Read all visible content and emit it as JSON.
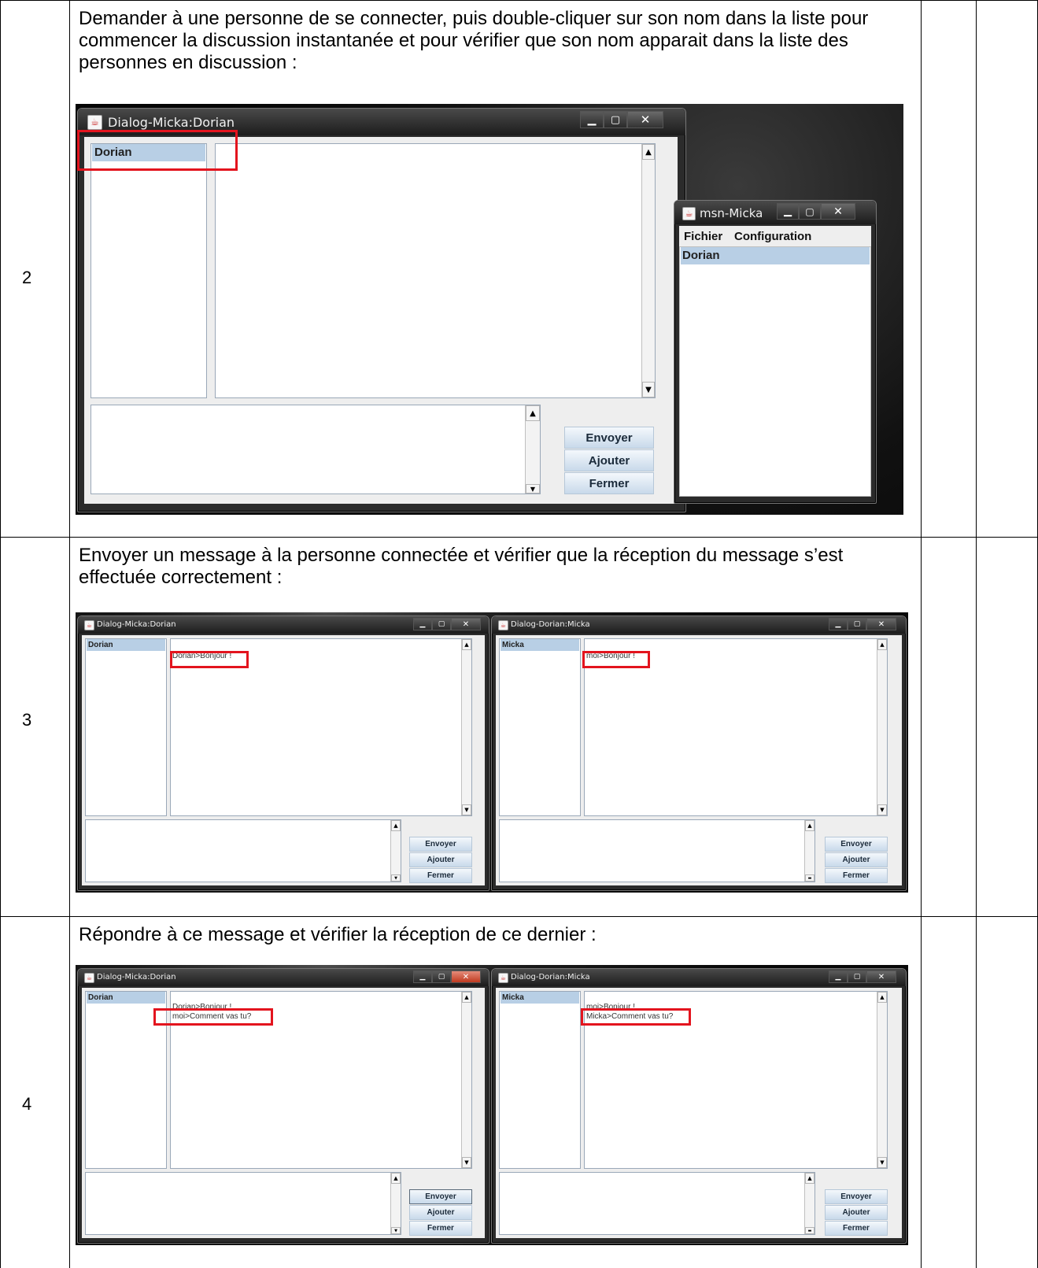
{
  "rows": [
    {
      "step": "2",
      "instruction": "Demander à une personne de se connecter, puis double-cliquer sur son nom dans la liste pour commencer la discussion instantanée et pour vérifier que son nom apparait dans la liste des personnes en discussion :",
      "dialog": {
        "title": "Dialog-Micka:Dorian",
        "user": "Dorian",
        "buttons": [
          "Envoyer",
          "Ajouter",
          "Fermer"
        ]
      },
      "msn_window": {
        "title": "msn-Micka",
        "menu": [
          "Fichier",
          "Configuration"
        ],
        "contacts": [
          "Dorian"
        ]
      }
    },
    {
      "step": "3",
      "instruction": "Envoyer un message à la personne connectée et vérifier que la réception du message s’est effectuée correctement :",
      "left_dialog": {
        "title": "Dialog-Micka:Dorian",
        "user": "Dorian",
        "messages": [
          "Dorian>Bonjour !"
        ],
        "buttons": [
          "Envoyer",
          "Ajouter",
          "Fermer"
        ]
      },
      "right_dialog": {
        "title": "Dialog-Dorian:Micka",
        "user": "Micka",
        "messages": [
          "moi>Bonjour !"
        ],
        "buttons": [
          "Envoyer",
          "Ajouter",
          "Fermer"
        ]
      }
    },
    {
      "step": "4",
      "instruction": "Répondre à ce message et vérifier la réception de ce dernier :",
      "left_dialog": {
        "title": "Dialog-Micka:Dorian",
        "user": "Dorian",
        "messages": [
          "Dorian>Bonjour !",
          "moi>Comment vas tu?"
        ],
        "buttons": [
          "Envoyer",
          "Ajouter",
          "Fermer"
        ]
      },
      "right_dialog": {
        "title": "Dialog-Dorian:Micka",
        "user": "Micka",
        "messages": [
          "moi>Bonjour !",
          "Micka>Comment vas tu?"
        ],
        "buttons": [
          "Envoyer",
          "Ajouter",
          "Fermer"
        ]
      }
    }
  ],
  "colors": {
    "highlight": "#e3141e",
    "selection": "#b8cfe5",
    "button": "#c8d9ea"
  }
}
